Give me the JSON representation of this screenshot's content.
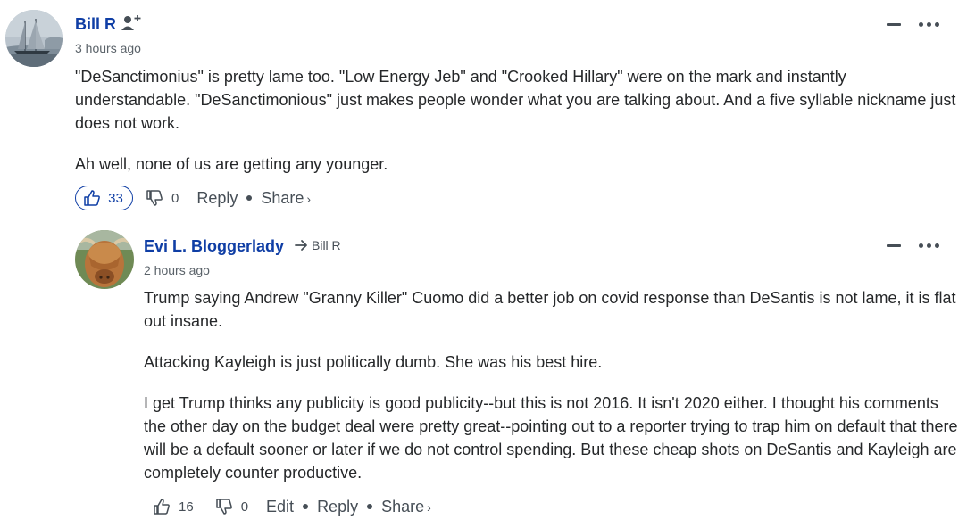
{
  "comment1": {
    "author": "Bill R",
    "time": "3 hours ago",
    "paragraphs": [
      "\"DeSanctimonius\" is pretty lame too. \"Low Energy Jeb\" and \"Crooked Hillary\" were on the mark and instantly understandable. \"DeSanctimonious\" just makes people wonder what you are talking about. And a five syllable nickname just does not work.",
      "Ah well, none of us are getting any younger."
    ],
    "likes": "33",
    "dislikes": "0",
    "reply": "Reply",
    "share": "Share",
    "share_chev": "›"
  },
  "comment2": {
    "author": "Evi L. Bloggerlady",
    "reply_to": "Bill R",
    "time": "2 hours ago",
    "paragraphs": [
      "Trump saying Andrew \"Granny Killer\" Cuomo did a better job on covid response than DeSantis is not lame, it is flat out insane.",
      "Attacking Kayleigh is just politically dumb. She was his best hire.",
      "I get Trump thinks any publicity is good publicity--but this is not 2016. It isn't 2020 either. I thought his comments the other day on the budget deal were pretty great--pointing out to a reporter trying to trap him on default that there will be a default sooner or later if we do not control spending. But these cheap shots on DeSantis and Kayleigh are completely counter productive."
    ],
    "likes": "16",
    "dislikes": "0",
    "edit": "Edit",
    "reply": "Reply",
    "share": "Share",
    "share_chev": "›"
  },
  "icons": {
    "follow": "follow-user-icon",
    "collapse": "minus-icon",
    "more": "more-dots-icon",
    "like": "thumbs-up-icon",
    "dislike": "thumbs-down-icon",
    "reply_arrow": "reply-arrow-icon"
  },
  "colors": {
    "author": "#0f3ea5",
    "text": "#26282a",
    "meta": "#5b636a",
    "like_active": "#0f3ea5"
  }
}
